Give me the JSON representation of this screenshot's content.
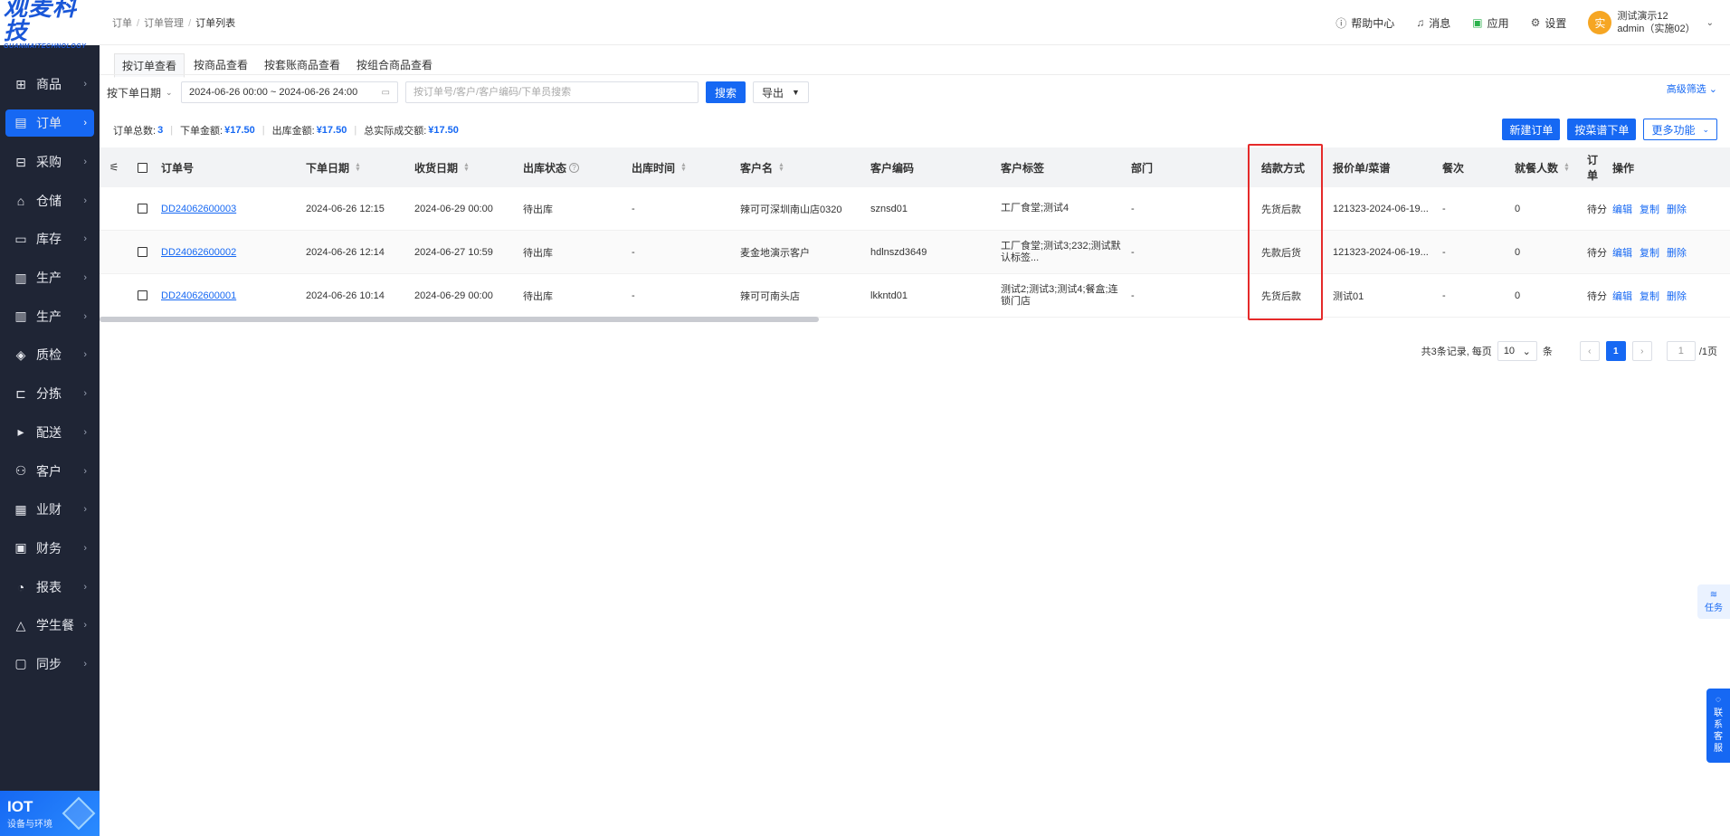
{
  "logo": {
    "brand": "观麦科技",
    "sub": "GUANMAITECHNOLOGY"
  },
  "nav": [
    {
      "label": "商品",
      "icon": "grid-icon"
    },
    {
      "label": "订单",
      "icon": "order-icon",
      "active": true
    },
    {
      "label": "采购",
      "icon": "cart-icon"
    },
    {
      "label": "仓储",
      "icon": "warehouse-icon"
    },
    {
      "label": "库存",
      "icon": "inventory-icon"
    },
    {
      "label": "生产",
      "icon": "factory-icon"
    },
    {
      "label": "生产",
      "icon": "factory-icon"
    },
    {
      "label": "质检",
      "icon": "shield-icon"
    },
    {
      "label": "分拣",
      "icon": "sort-icon"
    },
    {
      "label": "配送",
      "icon": "truck-icon"
    },
    {
      "label": "客户",
      "icon": "user-icon"
    },
    {
      "label": "业财",
      "icon": "chart-icon"
    },
    {
      "label": "财务",
      "icon": "wallet-icon"
    },
    {
      "label": "报表",
      "icon": "report-icon"
    },
    {
      "label": "学生餐",
      "icon": "meal-icon"
    },
    {
      "label": "同步",
      "icon": "sync-icon"
    }
  ],
  "iot": {
    "title": "IOT",
    "subtitle": "设备与环境"
  },
  "breadcrumb": [
    "订单",
    "订单管理",
    "订单列表"
  ],
  "topbar": {
    "help": "帮助中心",
    "messages": "消息",
    "apps": "应用",
    "settings": "设置",
    "avatar": "实",
    "user_name": "测试演示12",
    "user_account": "admin（实施02）"
  },
  "tabs": [
    "按订单查看",
    "按商品查看",
    "按套账商品查看",
    "按组合商品查看"
  ],
  "filter": {
    "date_type": "按下单日期",
    "date_range": "2024-06-26 00:00 ~ 2024-06-26 24:00",
    "search_placeholder": "按订单号/客户/客户编码/下单员搜索",
    "search_btn": "搜索",
    "export_btn": "导出",
    "advanced": "高级筛选"
  },
  "summary": {
    "total_label": "订单总数:",
    "total": "3",
    "amount_label": "下单金额:",
    "amount": "¥17.50",
    "out_label": "出库金额:",
    "out": "¥17.50",
    "actual_label": "总实际成交额:",
    "actual": "¥17.50"
  },
  "actions": {
    "new": "新建订单",
    "by_menu": "按菜谱下单",
    "more": "更多功能"
  },
  "columns": [
    "订单号",
    "下单日期",
    "收货日期",
    "出库状态",
    "出库时间",
    "客户名",
    "客户编码",
    "客户标签",
    "部门",
    "结款方式",
    "报价单/菜谱",
    "餐次",
    "就餐人数",
    "订单",
    "操作"
  ],
  "rows": [
    {
      "id": "DD24062600003",
      "order_date": "2024-06-26 12:15",
      "recv_date": "2024-06-29 00:00",
      "status": "待出库",
      "out_time": "-",
      "customer": "辣可可深圳南山店0320",
      "code": "sznsd01",
      "tag": "工厂食堂;测试4",
      "dept": "-",
      "pay": "先货后款",
      "quote": "121323-2024-06-19...",
      "meal": "-",
      "people": "0",
      "order_st": "待分"
    },
    {
      "id": "DD24062600002",
      "order_date": "2024-06-26 12:14",
      "recv_date": "2024-06-27 10:59",
      "status": "待出库",
      "out_time": "-",
      "customer": "麦金地演示客户",
      "code": "hdlnszd3649",
      "tag": "工厂食堂;测试3;232;测试默认标签...",
      "dept": "-",
      "pay": "先款后货",
      "quote": "121323-2024-06-19...",
      "meal": "-",
      "people": "0",
      "order_st": "待分"
    },
    {
      "id": "DD24062600001",
      "order_date": "2024-06-26 10:14",
      "recv_date": "2024-06-29 00:00",
      "status": "待出库",
      "out_time": "-",
      "customer": "辣可可南头店",
      "code": "lkkntd01",
      "tag": "测试2;测试3;测试4;餐盒;连锁门店",
      "dept": "-",
      "pay": "先货后款",
      "quote": "测试01",
      "meal": "-",
      "people": "0",
      "order_st": "待分"
    }
  ],
  "row_ops": [
    "编辑",
    "复制",
    "删除"
  ],
  "pager": {
    "info": "共3条记录, 每页",
    "size": "10",
    "unit": "条",
    "current": "1",
    "jump": "1",
    "total": "/1页"
  },
  "float": {
    "task": "任务",
    "cs": [
      "联",
      "系",
      "客",
      "服"
    ]
  }
}
